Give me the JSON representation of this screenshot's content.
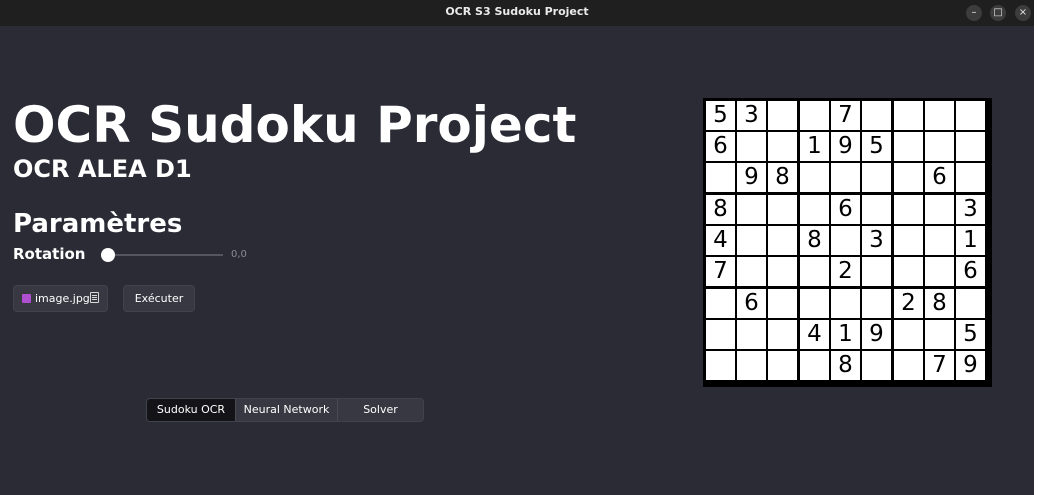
{
  "window": {
    "title": "OCR S3 Sudoku Project",
    "controls": {
      "minimize": "–",
      "maximize": "□",
      "close": "×"
    }
  },
  "header": {
    "title": "OCR Sudoku Project",
    "subtitle": "OCR ALEA D1"
  },
  "parameters": {
    "heading": "Paramètres",
    "rotation_label": "Rotation",
    "rotation_value": "0,0",
    "rotation_fraction": 0
  },
  "file_button": {
    "label": "image.jpg",
    "icon": "image-file-icon"
  },
  "execute_button": {
    "label": "Exécuter"
  },
  "tabs": [
    {
      "label": "Sudoku OCR",
      "active": true
    },
    {
      "label": "Neural Network",
      "active": false
    },
    {
      "label": "Solver",
      "active": false
    }
  ],
  "sudoku": {
    "rows": [
      [
        "5",
        "3",
        "",
        "",
        "7",
        "",
        "",
        "",
        ""
      ],
      [
        "6",
        "",
        "",
        "1",
        "9",
        "5",
        "",
        "",
        ""
      ],
      [
        "",
        "9",
        "8",
        "",
        "",
        "",
        "",
        "6",
        ""
      ],
      [
        "8",
        "",
        "",
        "",
        "6",
        "",
        "",
        "",
        "3"
      ],
      [
        "4",
        "",
        "",
        "8",
        "",
        "3",
        "",
        "",
        "1"
      ],
      [
        "7",
        "",
        "",
        "",
        "2",
        "",
        "",
        "",
        "6"
      ],
      [
        "",
        "6",
        "",
        "",
        "",
        "",
        "2",
        "8",
        ""
      ],
      [
        "",
        "",
        "",
        "4",
        "1",
        "9",
        "",
        "",
        "5"
      ],
      [
        "",
        "",
        "",
        "",
        "8",
        "",
        "",
        "7",
        "9"
      ]
    ]
  },
  "colors": {
    "background": "#2b2b36",
    "titlebar": "#1f1f1f",
    "button": "#383843",
    "active_tab": "#141418"
  }
}
